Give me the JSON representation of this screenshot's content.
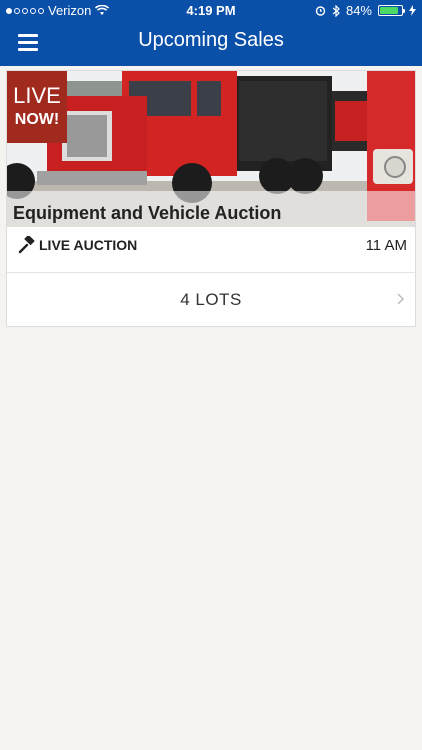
{
  "status_bar": {
    "carrier": "Verizon",
    "time": "4:19 PM",
    "battery": "84%",
    "battery_level": 0.84,
    "signal_bars_filled": 1,
    "signal_bars_total": 5
  },
  "header": {
    "title": "Upcoming Sales",
    "color": "#0a4fa8"
  },
  "sales": [
    {
      "badge": {
        "line1": "LIVE",
        "line2": "NOW!"
      },
      "title": "Equipment and Vehicle Auction",
      "type": "LIVE AUCTION",
      "time": "11 AM",
      "lots": "4 LOTS"
    }
  ],
  "colors": {
    "badge": "#a02a1d",
    "background": "#f4f3ef"
  }
}
